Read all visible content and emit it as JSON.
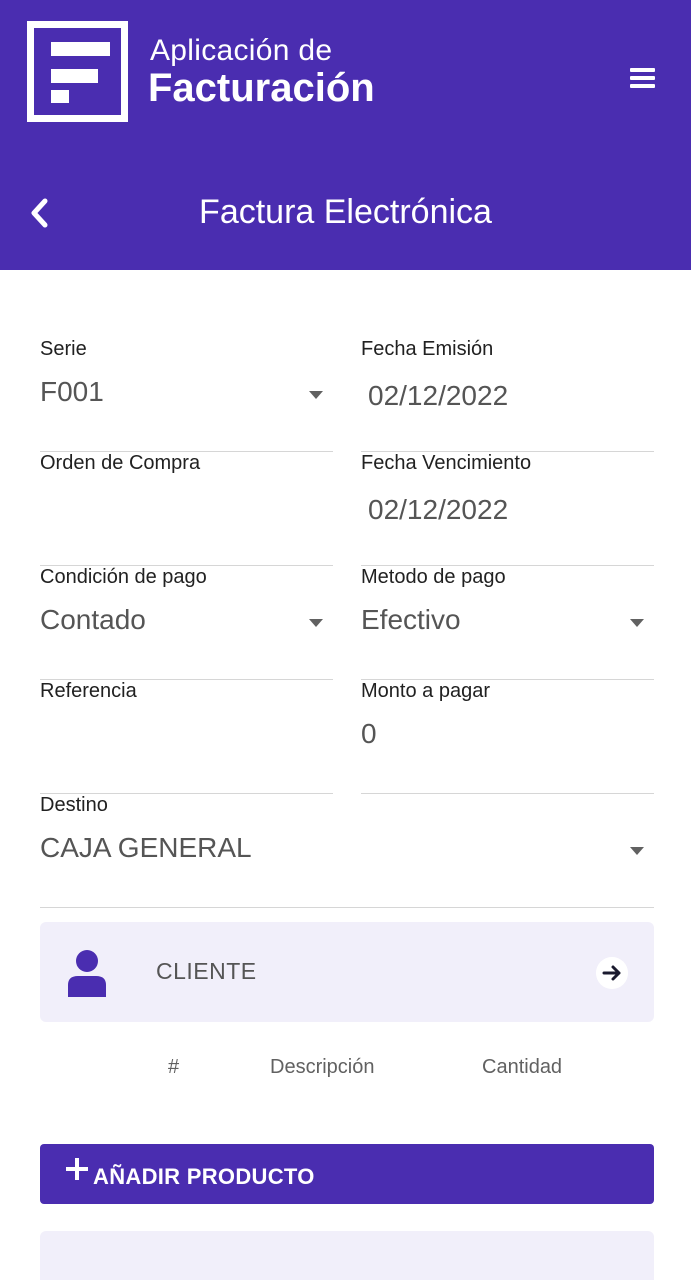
{
  "app": {
    "title_line1": "Aplicación de",
    "title_line2": "Facturación",
    "logo_icon": "invoice-f-logo",
    "menu_icon": "hamburger-menu-icon"
  },
  "page": {
    "title": "Factura Electrónica",
    "back_icon": "chevron-left-icon"
  },
  "form": {
    "serie": {
      "label": "Serie",
      "value": "F001"
    },
    "fecha_emision": {
      "label": "Fecha Emisión",
      "value": "02/12/2022"
    },
    "orden_compra": {
      "label": "Orden de Compra",
      "value": ""
    },
    "fecha_vencimiento": {
      "label": "Fecha Vencimiento",
      "value": "02/12/2022"
    },
    "condicion_pago": {
      "label": "Condición de pago",
      "value": "Contado"
    },
    "metodo_pago": {
      "label": "Metodo de pago",
      "value": "Efectivo"
    },
    "referencia": {
      "label": "Referencia",
      "value": ""
    },
    "monto": {
      "label": "Monto a pagar",
      "value": "0"
    },
    "destino": {
      "label": "Destino",
      "value": "CAJA GENERAL"
    }
  },
  "client": {
    "label": "CLIENTE",
    "icon": "person-icon",
    "action_icon": "arrow-right-icon"
  },
  "products_table": {
    "columns": [
      "#",
      "Descripción",
      "Cantidad"
    ]
  },
  "actions": {
    "add_product": "AÑADIR PRODUCTO",
    "add_icon": "plus-icon"
  },
  "colors": {
    "primary": "#4a2db0",
    "card_bg": "#f1effa"
  }
}
